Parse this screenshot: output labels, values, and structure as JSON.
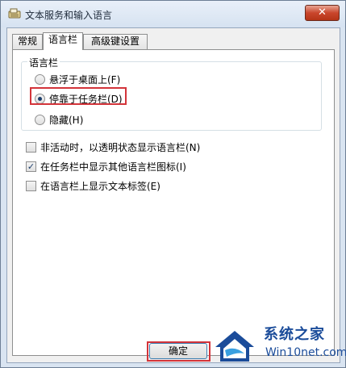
{
  "window": {
    "title": "文本服务和输入语言",
    "close_label": "✕"
  },
  "tabs": [
    {
      "label": "常规",
      "active": false
    },
    {
      "label": "语言栏",
      "active": true
    },
    {
      "label": "高级键设置",
      "active": false
    }
  ],
  "language_bar": {
    "group_title": "语言栏",
    "options": [
      {
        "label": "悬浮于桌面上(F)",
        "checked": false
      },
      {
        "label": "停靠于任务栏(D)",
        "checked": true
      },
      {
        "label": "隐藏(H)",
        "checked": false
      }
    ]
  },
  "checkboxes": [
    {
      "label": "非活动时，以透明状态显示语言栏(N)",
      "checked": false
    },
    {
      "label": "在任务栏中显示其他语言栏图标(I)",
      "checked": true
    },
    {
      "label": "在语言栏上显示文本标签(E)",
      "checked": false
    }
  ],
  "buttons": {
    "ok_label": "确定"
  },
  "watermark": {
    "title": "系统之家",
    "url": "Win10net.com"
  },
  "colors": {
    "highlight": "#d3343a",
    "brand": "#1b4c9a"
  }
}
